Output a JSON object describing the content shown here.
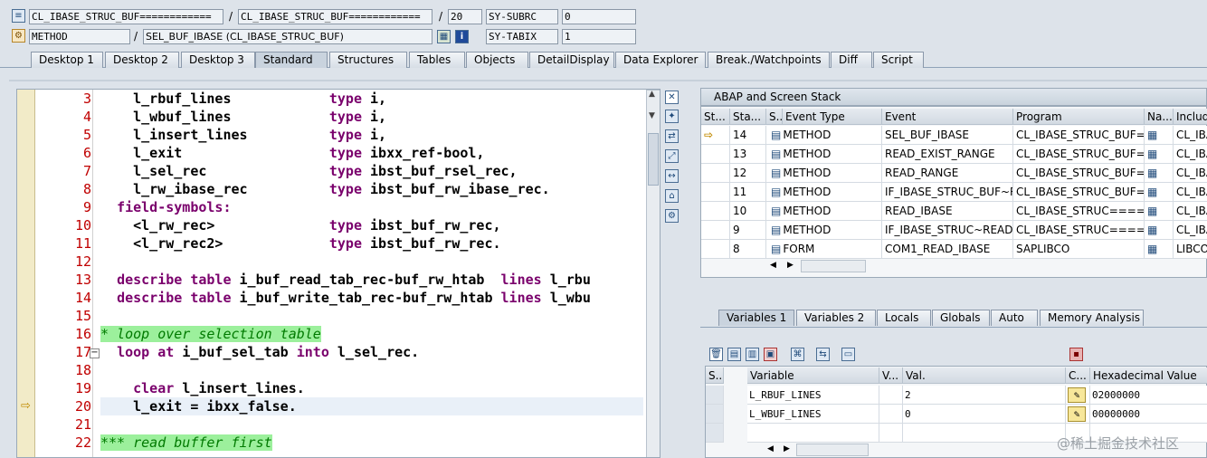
{
  "top": {
    "row1": {
      "field1": "CL_IBASE_STRUC_BUF============",
      "sep1": "/",
      "field2": "CL_IBASE_STRUC_BUF============",
      "sep2": "/",
      "field3": "20",
      "sys_label": "SY-SUBRC",
      "sys_value": "0"
    },
    "row2": {
      "field1": "METHOD",
      "sep1": "/",
      "field2": "SEL_BUF_IBASE (CL_IBASE_STRUC_BUF)",
      "sys_label": "SY-TABIX",
      "sys_value": "1"
    }
  },
  "tabs": [
    "Desktop 1",
    "Desktop 2",
    "Desktop 3",
    "Standard",
    "Structures",
    "Tables",
    "Objects",
    "DetailDisplay",
    "Data Explorer",
    "Break./Watchpoints",
    "Diff",
    "Script"
  ],
  "active_tab": "Standard",
  "code": [
    {
      "n": "3",
      "text": "    l_rbuf_lines            type i,"
    },
    {
      "n": "4",
      "text": "    l_wbuf_lines            type i,"
    },
    {
      "n": "5",
      "text": "    l_insert_lines          type i,"
    },
    {
      "n": "6",
      "text": "    l_exit                  type ibxx_ref-bool,"
    },
    {
      "n": "7",
      "text": "    l_sel_rec               type ibst_buf_rsel_rec,"
    },
    {
      "n": "8",
      "text": "    l_rw_ibase_rec          type ibst_buf_rw_ibase_rec."
    },
    {
      "n": "9",
      "text": "  field-symbols:"
    },
    {
      "n": "10",
      "text": "    <l_rw_rec>              type ibst_buf_rw_rec,"
    },
    {
      "n": "11",
      "text": "    <l_rw_rec2>             type ibst_buf_rw_rec."
    },
    {
      "n": "12",
      "text": ""
    },
    {
      "n": "13",
      "text": "  describe table i_buf_read_tab_rec-buf_rw_htab  lines l_rbu"
    },
    {
      "n": "14",
      "text": "  describe table i_buf_write_tab_rec-buf_rw_htab lines l_wbu"
    },
    {
      "n": "15",
      "text": ""
    },
    {
      "n": "16",
      "text": "* loop over selection table"
    },
    {
      "n": "17",
      "text": "  loop at i_buf_sel_tab into l_sel_rec."
    },
    {
      "n": "18",
      "text": ""
    },
    {
      "n": "19",
      "text": "    clear l_insert_lines."
    },
    {
      "n": "20",
      "text": "    l_exit = ibxx_false."
    },
    {
      "n": "21",
      "text": ""
    },
    {
      "n": "22",
      "text": "*** read buffer first"
    }
  ],
  "stack": {
    "title": "ABAP and Screen Stack",
    "headers": [
      "St...",
      "Sta...",
      "S...",
      "Event Type",
      "Event",
      "Program",
      "Na...",
      "Includ"
    ],
    "rows": [
      {
        "sta": "14",
        "type": "METHOD",
        "event": "SEL_BUF_IBASE",
        "program": "CL_IBASE_STRUC_BUF=...",
        "inc": "CL_IBA",
        "current": true
      },
      {
        "sta": "13",
        "type": "METHOD",
        "event": "READ_EXIST_RANGE",
        "program": "CL_IBASE_STRUC_BUF=...",
        "inc": "CL_IBA",
        "current": false
      },
      {
        "sta": "12",
        "type": "METHOD",
        "event": "READ_RANGE",
        "program": "CL_IBASE_STRUC_BUF=...",
        "inc": "CL_IBA",
        "current": false
      },
      {
        "sta": "11",
        "type": "METHOD",
        "event": "IF_IBASE_STRUC_BUF~R...",
        "program": "CL_IBASE_STRUC_BUF=...",
        "inc": "CL_IBA",
        "current": false
      },
      {
        "sta": "10",
        "type": "METHOD",
        "event": "READ_IBASE",
        "program": "CL_IBASE_STRUC=====...",
        "inc": "CL_IBA",
        "current": false
      },
      {
        "sta": "9",
        "type": "METHOD",
        "event": "IF_IBASE_STRUC~READ...",
        "program": "CL_IBASE_STRUC=====...",
        "inc": "CL_IBA",
        "current": false
      },
      {
        "sta": "8",
        "type": "FORM",
        "event": "COM1_READ_IBASE",
        "program": "SAPLIBCO",
        "inc": "LIBCOF",
        "current": false
      }
    ]
  },
  "var_tabs": [
    "Variables 1",
    "Variables 2",
    "Locals",
    "Globals",
    "Auto",
    "Memory Analysis"
  ],
  "active_var_tab": "Variables 1",
  "vars": {
    "headers": [
      "S...",
      "Variable",
      "V...",
      "Val.",
      "C...",
      "Hexadecimal Value"
    ],
    "rows": [
      {
        "name": "L_RBUF_LINES",
        "value": "2",
        "hex": "02000000"
      },
      {
        "name": "L_WBUF_LINES",
        "value": "0",
        "hex": "00000000"
      }
    ]
  },
  "watermark": "@稀土掘金技术社区",
  "colors": {
    "keyword": "#7a006c",
    "line_number": "#c00000",
    "comment_bg": "#9cf09c",
    "comment_fg": "#007a00"
  }
}
